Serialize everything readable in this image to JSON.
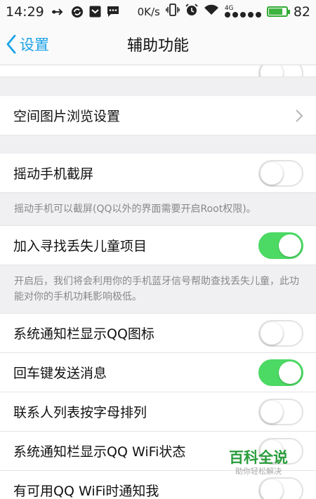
{
  "status_bar": {
    "time": "14:29",
    "network_speed": "0K/s",
    "network_type": "4G",
    "battery_level": "82",
    "battery_fraction": 0.82
  },
  "nav": {
    "back_label": "设置",
    "title": "辅助功能"
  },
  "rows": {
    "space_image": {
      "label": "空间图片浏览设置"
    },
    "shake_screenshot": {
      "label": "摇动手机截屏",
      "on": false,
      "desc": "摇动手机可以截屏(QQ以外的界面需要开启Root权限)。"
    },
    "find_children": {
      "label": "加入寻找丢失儿童项目",
      "on": true,
      "desc": "开启后，我们将会利用你的手机蓝牙信号帮助查找丢失儿童，此功能对你的手机功耗影响极低。"
    },
    "notif_qq_icon": {
      "label": "系统通知栏显示QQ图标",
      "on": false
    },
    "enter_send": {
      "label": "回车键发送消息",
      "on": true
    },
    "contacts_sort": {
      "label": "联系人列表按字母排列",
      "on": false
    },
    "notif_wifi": {
      "label": "系统通知栏显示QQ WiFi状态",
      "on": false
    },
    "partial_next": {
      "label": "有可用QQ WiFi时通知我",
      "on": false
    }
  },
  "watermark": {
    "title": "百科全说",
    "subtitle": "助你轻松解决"
  },
  "colors": {
    "accent": "#1aa3e8",
    "toggle_on": "#4cd964",
    "watermark": "#2a9d3c"
  }
}
